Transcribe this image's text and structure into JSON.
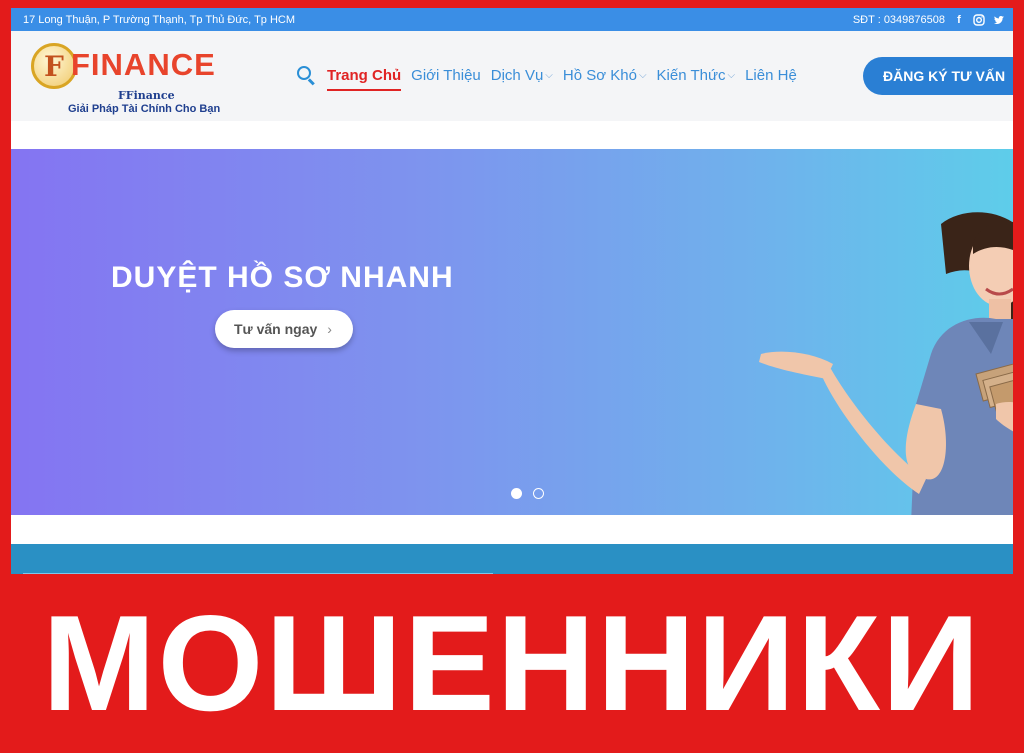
{
  "topbar": {
    "address": "17 Long Thuận, P Trường Thạnh, Tp Thủ Đức, Tp HCM",
    "phone": "SĐT : 0349876508",
    "social": [
      "facebook-icon",
      "instagram-icon",
      "twitter-icon"
    ]
  },
  "logo": {
    "letter": "F",
    "word": "FINANCE",
    "brand": "FFinance",
    "tagline": "Giải Pháp Tài Chính Cho Bạn"
  },
  "nav": {
    "items": [
      {
        "label": "Trang Chủ",
        "active": true
      },
      {
        "label": "Giới Thiệu"
      },
      {
        "label": "Dịch Vụ",
        "dropdown": true
      },
      {
        "label": "Hồ Sơ Khó",
        "dropdown": true
      },
      {
        "label": "Kiến Thức",
        "dropdown": true
      },
      {
        "label": "Liên Hệ"
      }
    ],
    "cta": "ĐĂNG KÝ TƯ VẤN"
  },
  "hero": {
    "title": "DUYỆT HỒ SƠ NHANH",
    "button": "Tư vấn ngay",
    "slides": 2,
    "active_slide": 1
  },
  "overlay": {
    "text": "МОШЕННИКИ"
  },
  "colors": {
    "frame_red": "#e31b1b",
    "topbar_blue": "#3a8ee6",
    "nav_blue": "#3a8ed8",
    "nav_active": "#e02424",
    "cta_blue": "#2a7fd4"
  }
}
